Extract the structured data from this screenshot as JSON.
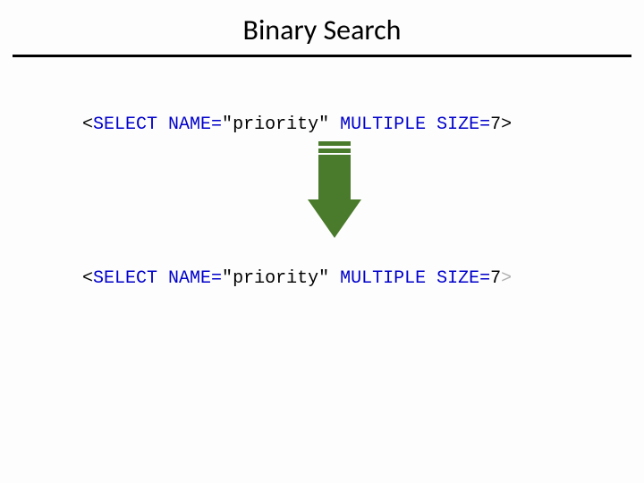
{
  "title": "Binary Search",
  "line1": {
    "lt": "<",
    "select": "SELECT ",
    "name_attr": "NAME=",
    "quote1": "\"",
    "name_val": "priority",
    "quote2": "\"",
    "space": " ",
    "multiple": "MULTIPLE ",
    "size_attr": "SIZE=",
    "size_val": "7",
    "gt": ">"
  },
  "line2": {
    "lt": "<",
    "select": "SELECT ",
    "name_attr": "NAME=",
    "quote1": "\"",
    "name_val": "priority",
    "quote2": "\"",
    "space": " ",
    "multiple": "MULTIPLE ",
    "size_attr": "SIZE=",
    "size_val": "7",
    "gt": ">"
  },
  "arrow_color": "#4a7a2b"
}
